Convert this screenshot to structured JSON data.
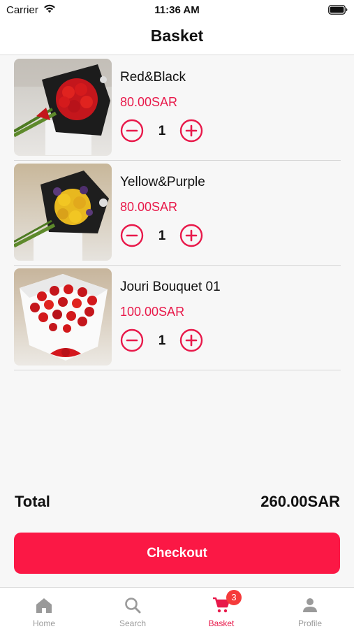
{
  "status_bar": {
    "carrier": "Carrier",
    "time": "11:36 AM",
    "wifi_icon": "wifi-icon",
    "battery_icon": "battery-icon"
  },
  "header": {
    "title": "Basket"
  },
  "basket": {
    "items": [
      {
        "name": "Red&Black",
        "price": "80.00SAR",
        "quantity": "1",
        "image": "red-roses-black-wrap-bouquet"
      },
      {
        "name": "Yellow&Purple",
        "price": "80.00SAR",
        "quantity": "1",
        "image": "yellow-purple-flowers-black-wrap-bouquet"
      },
      {
        "name": "Jouri Bouquet 01",
        "price": "100.00SAR",
        "quantity": "1",
        "image": "red-roses-white-wrap-bouquet"
      }
    ]
  },
  "summary": {
    "total_label": "Total",
    "total_value": "260.00SAR"
  },
  "checkout": {
    "label": "Checkout"
  },
  "tab_bar": {
    "tabs": [
      {
        "label": "Home",
        "icon": "home-icon",
        "active": false
      },
      {
        "label": "Search",
        "icon": "search-icon",
        "active": false
      },
      {
        "label": "Basket",
        "icon": "cart-icon",
        "active": true,
        "badge": "3"
      },
      {
        "label": "Profile",
        "icon": "person-icon",
        "active": false
      }
    ]
  },
  "colors": {
    "accent": "#fb1845",
    "price": "#e8194a",
    "badge": "#f53b3b",
    "inactive_tab": "#9a9a9a"
  }
}
